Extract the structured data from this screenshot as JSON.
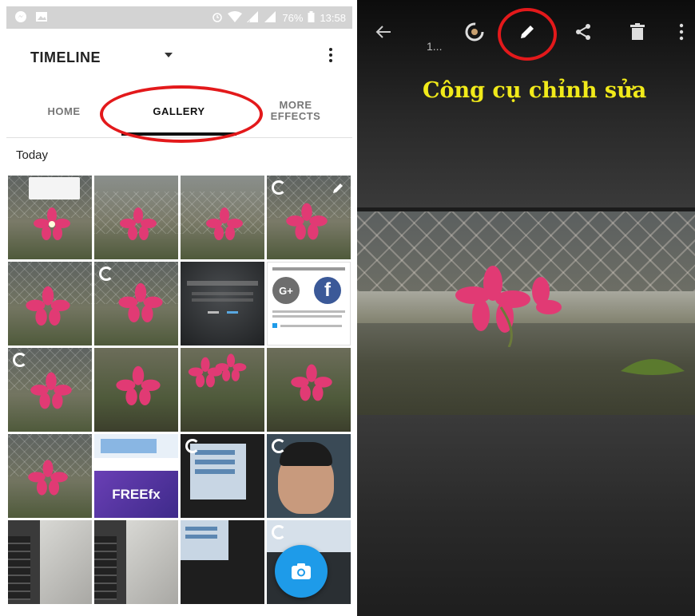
{
  "status_bar": {
    "battery": "76%",
    "time": "13:58"
  },
  "left": {
    "title": "TIMELINE",
    "tabs": [
      "HOME",
      "GALLERY",
      "MORE EFFECTS"
    ],
    "active_tab": "GALLERY",
    "section_label": "Today",
    "accent": "#1e9be9",
    "highlight_color": "#e3191b"
  },
  "right": {
    "counter": "1...",
    "caption": "Công cụ chỉnh sửa",
    "caption_color": "#f1ea1a"
  },
  "thumbnails": {
    "g_plus": "G+",
    "facebook": "f",
    "freefx": "FREEfx"
  }
}
